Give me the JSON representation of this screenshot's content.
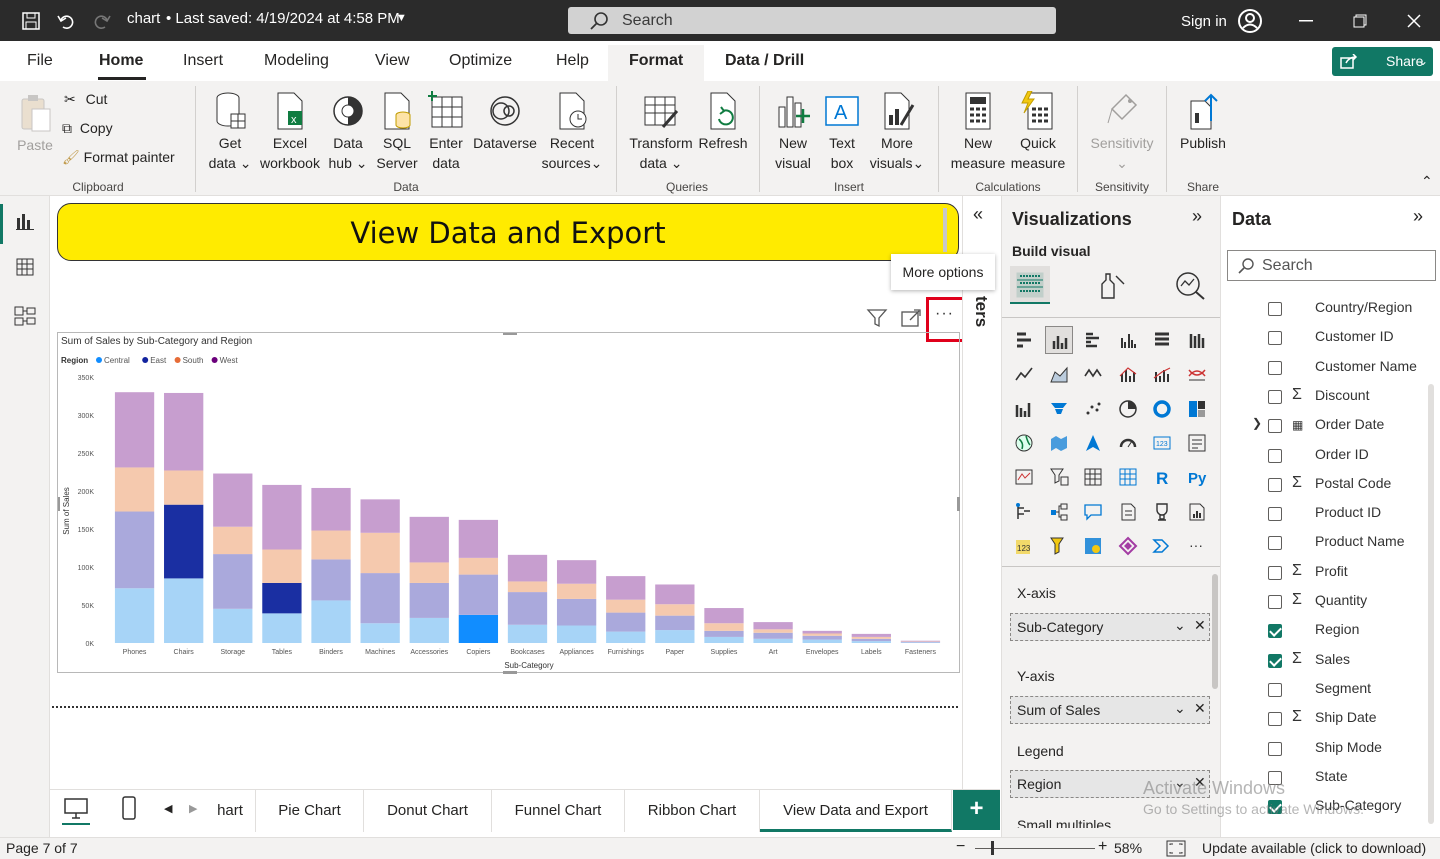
{
  "titlebar": {
    "doc_name": "chart",
    "saved": "• Last saved: 4/19/2024 at 4:58 PM",
    "search_placeholder": "Search",
    "sign_in": "Sign in"
  },
  "menu": {
    "tabs": [
      "File",
      "Home",
      "Insert",
      "Modeling",
      "View",
      "Optimize",
      "Help"
    ],
    "context_tabs": [
      "Format",
      "Data / Drill"
    ],
    "share": "Share"
  },
  "ribbon": {
    "clipboard": {
      "paste": "Paste",
      "cut": "Cut",
      "copy": "Copy",
      "format_painter": "Format painter",
      "group": "Clipboard"
    },
    "data": {
      "get_data": [
        "Get",
        "data"
      ],
      "excel": [
        "Excel",
        "workbook"
      ],
      "data_hub": [
        "Data",
        "hub"
      ],
      "sql": [
        "SQL",
        "Server"
      ],
      "enter": [
        "Enter",
        "data"
      ],
      "dataverse": "Dataverse",
      "recent": [
        "Recent",
        "sources"
      ],
      "group": "Data"
    },
    "queries": {
      "transform": [
        "Transform",
        "data"
      ],
      "refresh": "Refresh",
      "group": "Queries"
    },
    "insert": {
      "new_visual": [
        "New",
        "visual"
      ],
      "text_box": [
        "Text",
        "box"
      ],
      "more_visuals": [
        "More",
        "visuals"
      ],
      "group": "Insert"
    },
    "calculations": {
      "new_measure": [
        "New",
        "measure"
      ],
      "quick_measure": [
        "Quick",
        "measure"
      ],
      "group": "Calculations"
    },
    "sensitivity": {
      "label": "Sensitivity",
      "group": "Sensitivity"
    },
    "share": {
      "publish": "Publish",
      "group": "Share"
    }
  },
  "canvas": {
    "banner_title": "View Data and Export",
    "tooltip": "More options",
    "filters_label": "ters"
  },
  "chart_data": {
    "type": "bar",
    "title": "Sum of Sales by Sub-Category and Region",
    "xlabel": "Sub-Category",
    "ylabel": "Sum of Sales",
    "legend_title": "Region",
    "legend_position": "top-left",
    "ylim": [
      0,
      350000
    ],
    "yticks": [
      "0K",
      "50K",
      "100K",
      "150K",
      "200K",
      "250K",
      "300K",
      "350K"
    ],
    "categories": [
      "Phones",
      "Chairs",
      "Storage",
      "Tables",
      "Binders",
      "Machines",
      "Accessories",
      "Copiers",
      "Bookcases",
      "Appliances",
      "Furnishings",
      "Paper",
      "Supplies",
      "Art",
      "Envelopes",
      "Labels",
      "Fasteners"
    ],
    "series": [
      {
        "name": "Central",
        "color": "#a7d4f7",
        "values": [
          72000,
          85000,
          45000,
          39000,
          56000,
          26000,
          33000,
          37000,
          24000,
          23000,
          15000,
          17000,
          8000,
          5500,
          4500,
          2500,
          800
        ]
      },
      {
        "name": "East",
        "color": "#aaa9dc",
        "values": [
          101000,
          97000,
          72000,
          40000,
          54000,
          66000,
          46000,
          53000,
          43000,
          35000,
          25000,
          19000,
          8000,
          8000,
          5000,
          3000,
          700
        ]
      },
      {
        "name": "South",
        "color": "#f5c9ae",
        "values": [
          58000,
          45000,
          36000,
          44000,
          38000,
          53000,
          27000,
          22000,
          14000,
          20000,
          17000,
          15000,
          10000,
          4500,
          3000,
          2500,
          500
        ]
      },
      {
        "name": "West",
        "color": "#c79ecf",
        "values": [
          99000,
          102000,
          70000,
          85000,
          56000,
          44000,
          60000,
          50000,
          35000,
          31000,
          31000,
          26000,
          20000,
          9500,
          3500,
          4000,
          1000
        ]
      }
    ],
    "highlight": {
      "East": [
        "Chairs",
        "Tables"
      ],
      "Central": [
        "Copiers"
      ]
    },
    "highlight_colors": {
      "East": "#1a2fa2",
      "Central": "#118dff"
    },
    "legend_colors": {
      "Central": "#118dff",
      "East": "#12239e",
      "South": "#e66c37",
      "West": "#6b007b"
    }
  },
  "viz": {
    "title": "Visualizations",
    "build_visual": "Build visual",
    "xaxis_label": "X-axis",
    "xaxis_value": "Sub-Category",
    "yaxis_label": "Y-axis",
    "yaxis_value": "Sum of Sales",
    "legend_label": "Legend",
    "legend_value": "Region",
    "small_multiples": "Small multiples"
  },
  "datapane": {
    "title": "Data",
    "search_placeholder": "Search",
    "fields": [
      {
        "name": "Country/Region",
        "checked": false,
        "sigma": false
      },
      {
        "name": "Customer ID",
        "checked": false,
        "sigma": false
      },
      {
        "name": "Customer Name",
        "checked": false,
        "sigma": false
      },
      {
        "name": "Discount",
        "checked": false,
        "sigma": true
      },
      {
        "name": "Order Date",
        "checked": false,
        "sigma": false,
        "date": true
      },
      {
        "name": "Order ID",
        "checked": false,
        "sigma": false
      },
      {
        "name": "Postal Code",
        "checked": false,
        "sigma": true
      },
      {
        "name": "Product ID",
        "checked": false,
        "sigma": false
      },
      {
        "name": "Product Name",
        "checked": false,
        "sigma": false
      },
      {
        "name": "Profit",
        "checked": false,
        "sigma": true
      },
      {
        "name": "Quantity",
        "checked": false,
        "sigma": true
      },
      {
        "name": "Region",
        "checked": true,
        "sigma": false
      },
      {
        "name": "Sales",
        "checked": true,
        "sigma": true
      },
      {
        "name": "Segment",
        "checked": false,
        "sigma": false
      },
      {
        "name": "Ship Date",
        "checked": false,
        "sigma": true
      },
      {
        "name": "Ship Mode",
        "checked": false,
        "sigma": false
      },
      {
        "name": "State",
        "checked": false,
        "sigma": false
      },
      {
        "name": "Sub-Category",
        "checked": true,
        "sigma": false
      }
    ]
  },
  "pagetabs": {
    "tabs": [
      "hart",
      "Pie Chart",
      "Donut Chart",
      "Funnel Chart",
      "Ribbon Chart",
      "View Data and Export"
    ],
    "active": "View Data and Export",
    "add": "+"
  },
  "status": {
    "page": "Page 7 of 7",
    "zoom": "58%",
    "update": "Update available (click to download)"
  },
  "watermark": {
    "line1": "Activate Windows",
    "line2": "Go to Settings to activate Windows."
  }
}
